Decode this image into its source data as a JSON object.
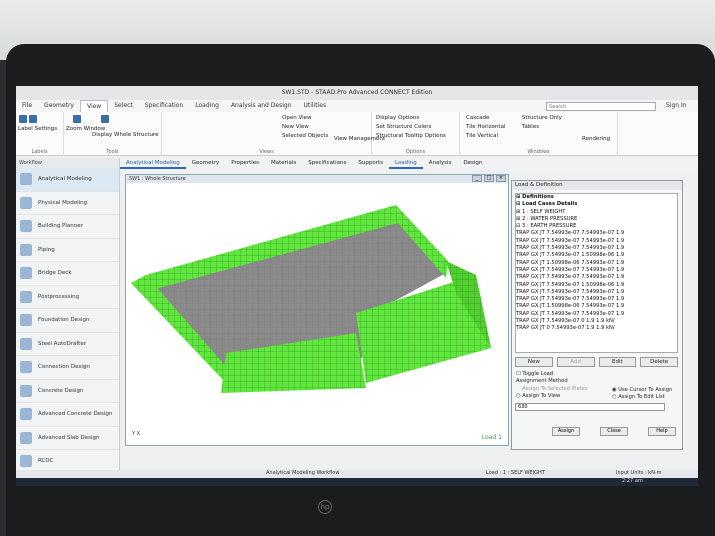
{
  "window": {
    "title": "SW1.STD - STAAD.Pro Advanced CONNECT Edition"
  },
  "menu_tabs": [
    {
      "label": "File"
    },
    {
      "label": "Geometry"
    },
    {
      "label": "View"
    },
    {
      "label": "Select"
    },
    {
      "label": "Specification"
    },
    {
      "label": "Loading"
    },
    {
      "label": "Analysis and Design"
    },
    {
      "label": "Utilities"
    }
  ],
  "search": {
    "placeholder": "Search"
  },
  "signin": "Sign In",
  "ribbon": {
    "label_settings": "Label Settings",
    "labels_group": "Labels",
    "zoom_window": "Zoom Window",
    "display_whole": "Display Whole Structure",
    "tools_group": "Tools",
    "open_view": "Open View",
    "new_view": "New View",
    "selected_objects": "Selected Objects",
    "view_management": "View Management",
    "views_group": "Views",
    "display_options": "Display Options",
    "set_structure_colors": "Set Structure Colors",
    "tooltip_options": "Structural Tooltip Options",
    "options_group": "Options",
    "cascade": "Cascade",
    "tile_horizontal": "Tile Horizontal",
    "tile_vertical": "Tile Vertical",
    "structure_only": "Structure Only",
    "tables": "Tables",
    "rendering": "Rendering",
    "windows_group": "Windows"
  },
  "sub_tabs": [
    {
      "label": "Analytical Modeling"
    },
    {
      "label": "Geometry"
    },
    {
      "label": "Properties"
    },
    {
      "label": "Materials"
    },
    {
      "label": "Specifications"
    },
    {
      "label": "Supports"
    },
    {
      "label": "Loading"
    },
    {
      "label": "Analysis"
    },
    {
      "label": "Design"
    }
  ],
  "sidebar": {
    "header": "Workflow",
    "items": [
      {
        "label": "Analytical Modeling"
      },
      {
        "label": "Physical Modeling"
      },
      {
        "label": "Building Planner"
      },
      {
        "label": "Piping"
      },
      {
        "label": "Bridge Deck"
      },
      {
        "label": "Postprocessing"
      },
      {
        "label": "Foundation Design"
      },
      {
        "label": "Steel AutoDrafter"
      },
      {
        "label": "Connection Design"
      },
      {
        "label": "Concrete Design"
      },
      {
        "label": "Advanced Concrete Design"
      },
      {
        "label": "Advanced Slab Design"
      },
      {
        "label": "RCDC"
      }
    ]
  },
  "viewport": {
    "title": "SW1 : Whole Structure",
    "load_label": "Load 1",
    "axis": "Y  X"
  },
  "panel": {
    "title": "Load & Definition",
    "tree": [
      {
        "text": "⊞ Definitions",
        "bold": true
      },
      {
        "text": "⊟ Load Cases Details",
        "bold": true
      },
      {
        "text": "  ⊞ 1 : SELF WEIGHT"
      },
      {
        "text": "  ⊞ 2 : WATER PRESSURE"
      },
      {
        "text": "  ⊟ 3 : EARTH PRESSURE"
      },
      {
        "text": "      TRAP GX JT 7.54993e-07 7.54993e-07 1.9"
      },
      {
        "text": "      TRAP GX JT 7.54993e-07 7.54993e-07 1.9"
      },
      {
        "text": "      TRAP GX JT 7.54993e-07 7.54993e-07 1.9"
      },
      {
        "text": "      TRAP GX JT 7.54993e-07 1.50998e-06 1.9"
      },
      {
        "text": "      TRAP GX JT 1.50998e-06 7.54993e-07 1.9"
      },
      {
        "text": "      TRAP GX JT 7.54993e-07 7.54993e-07 1.9"
      },
      {
        "text": "      TRAP GX JT 7.54993e-07 7.54993e-07 1.9"
      },
      {
        "text": "      TRAP GX JT 7.54993e-07 1.50998e-06 1.9"
      },
      {
        "text": "      TRAP GX JT 7.54993e-07 7.54993e-07 1.9"
      },
      {
        "text": "      TRAP GX JT 7.54993e-07 7.54993e-07 1.9"
      },
      {
        "text": "      TRAP GX JT 1.50998e-06 7.54993e-07 1.9"
      },
      {
        "text": "      TRAP GX JT 7.54993e-07 7.54993e-07 1.9"
      },
      {
        "text": "      TRAP GX JT 7.54993e-07 0 1.9 1.9 kN/"
      },
      {
        "text": "      TRAP GX JT 0 7.54993e-07 1.9 1.9 kN/"
      }
    ],
    "btn_new": "New",
    "btn_add": "Add",
    "btn_edit": "Edit",
    "btn_delete": "Delete",
    "toggle_load": "Toggle Load",
    "assignment_method": "Assignment Method",
    "assign_selected": "Assign To Selected Plates",
    "assign_view": "Assign To View",
    "use_cursor": "Use Cursor To Assign",
    "assign_edit": "Assign To Edit List",
    "input_value": "630",
    "btn_assign": "Assign",
    "btn_close": "Close",
    "btn_help": "Help"
  },
  "status": {
    "workflow": "Analytical Modeling Workflow",
    "load": "Load : 1 : SELF WEIGHT",
    "units": "Input Units : kN-m"
  },
  "taskbar": {
    "time": "2:27 am"
  }
}
